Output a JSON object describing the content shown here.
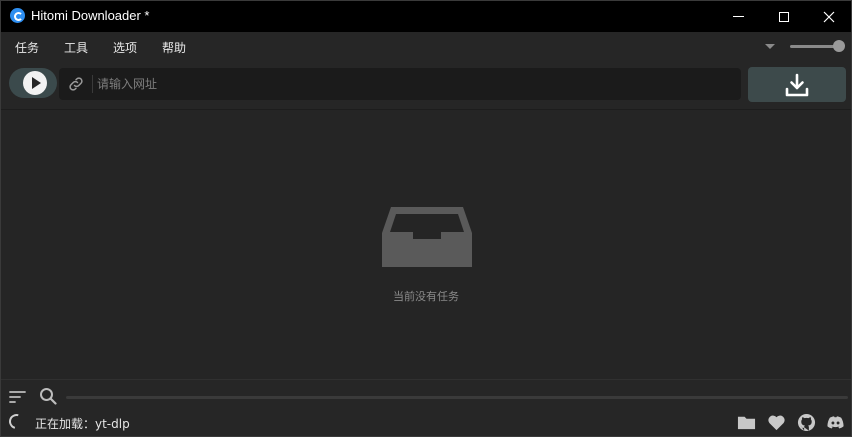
{
  "window": {
    "title": "Hitomi Downloader *",
    "icons": {
      "app": "hitomi-logo-icon",
      "minimize": "minimize-icon",
      "maximize": "maximize-icon",
      "close": "close-icon"
    }
  },
  "menu": {
    "items": [
      {
        "label": "任务"
      },
      {
        "label": "工具"
      },
      {
        "label": "选项"
      },
      {
        "label": "帮助"
      }
    ]
  },
  "volume": {
    "level": 0.9,
    "icon": "chevron-down-icon"
  },
  "toolbar": {
    "play_toggle_on": true,
    "url_placeholder": "请输入网址",
    "url_value": "",
    "icons": {
      "play": "play-icon",
      "link": "link-icon",
      "download": "download-icon"
    }
  },
  "main": {
    "empty_message": "当前没有任务",
    "icon": "empty-tray-icon"
  },
  "bottom": {
    "status": "正在加载：yt-dlp",
    "icons": [
      "sort-icon",
      "search-icon",
      "loading-spinner-icon",
      "folder-icon",
      "heart-icon",
      "github-icon",
      "discord-icon"
    ]
  },
  "colors": {
    "titlebar": "#000000",
    "background": "#262626",
    "accent": "#3d4a4b",
    "text": "#e8e8e8",
    "muted": "#8a8a8a"
  }
}
